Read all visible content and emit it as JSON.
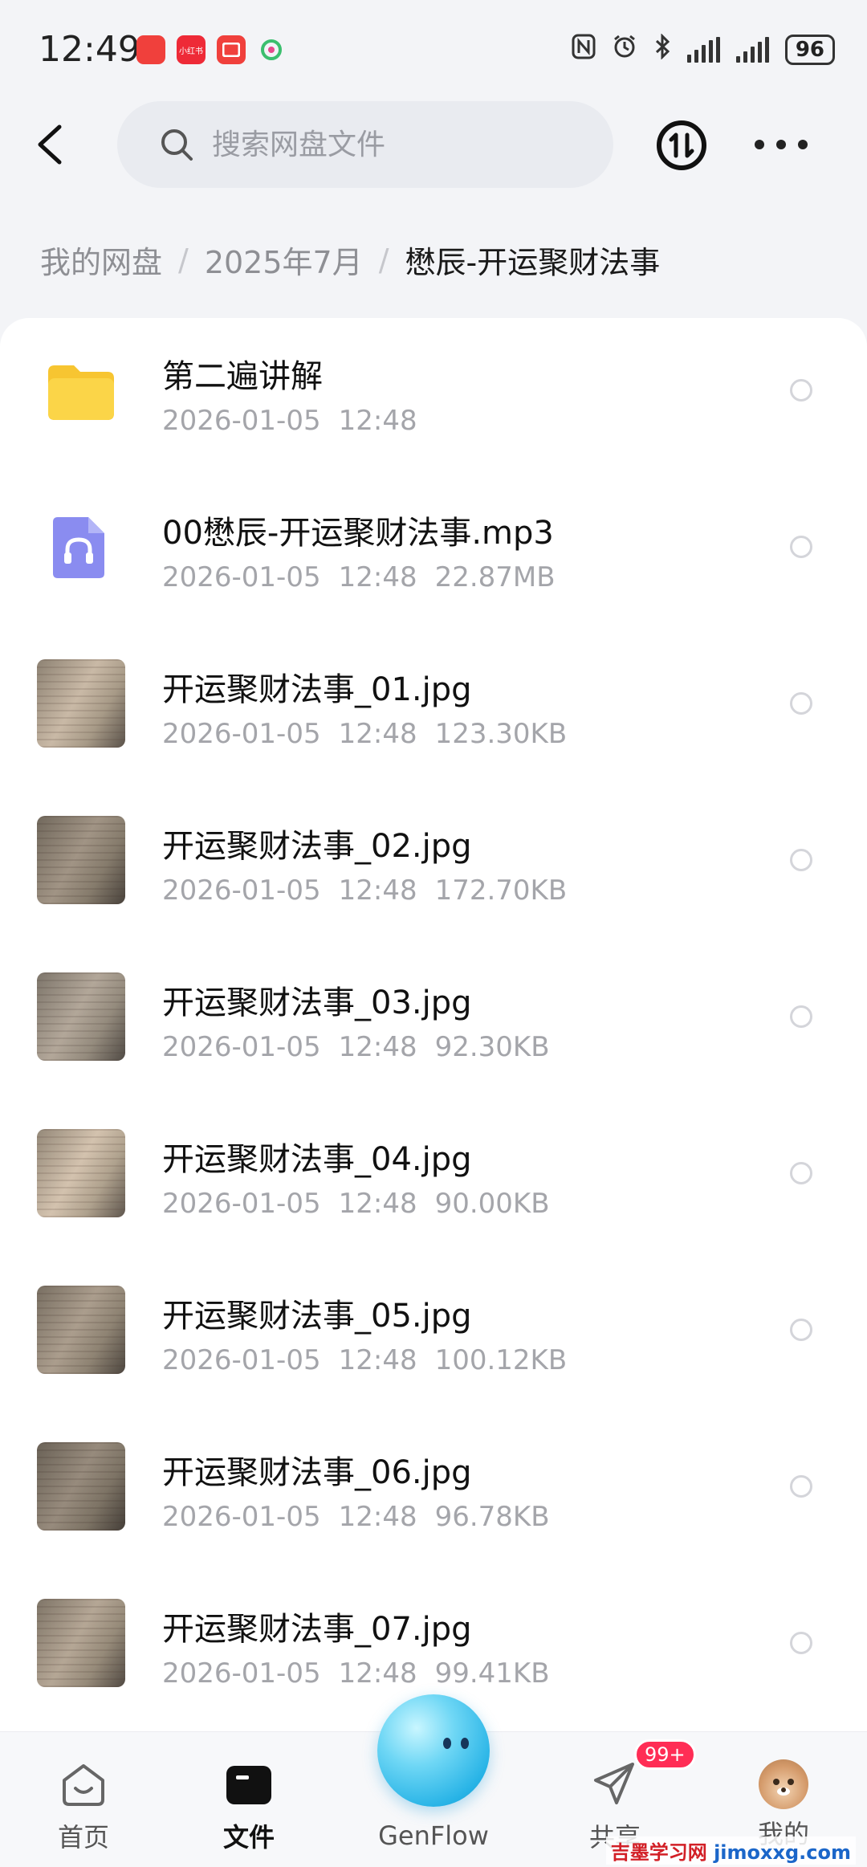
{
  "status_bar": {
    "time": "12:49",
    "battery": "96",
    "apps": [
      {
        "name": "app-badge-1",
        "color": "#f0403c"
      },
      {
        "name": "xiaohongshu-badge",
        "color": "#ee2a37",
        "label": "小红书"
      },
      {
        "name": "app-badge-3",
        "color": "#f0403c"
      },
      {
        "name": "app-badge-4",
        "color": "#3bbf6e"
      }
    ]
  },
  "header": {
    "search_placeholder": "搜索网盘文件"
  },
  "breadcrumb": {
    "root": "我的网盘",
    "level1": "2025年7月",
    "current": "懋辰-开运聚财法事"
  },
  "files": [
    {
      "name": "第二遍讲解",
      "date": "2026-01-05",
      "time": "12:48",
      "size": "",
      "type": "folder"
    },
    {
      "name": "00懋辰-开运聚财法事.mp3",
      "date": "2026-01-05",
      "time": "12:48",
      "size": "22.87MB",
      "type": "audio"
    },
    {
      "name": "开运聚财法事_01.jpg",
      "date": "2026-01-05",
      "time": "12:48",
      "size": "123.30KB",
      "type": "image"
    },
    {
      "name": "开运聚财法事_02.jpg",
      "date": "2026-01-05",
      "time": "12:48",
      "size": "172.70KB",
      "type": "image"
    },
    {
      "name": "开运聚财法事_03.jpg",
      "date": "2026-01-05",
      "time": "12:48",
      "size": "92.30KB",
      "type": "image"
    },
    {
      "name": "开运聚财法事_04.jpg",
      "date": "2026-01-05",
      "time": "12:48",
      "size": "90.00KB",
      "type": "image"
    },
    {
      "name": "开运聚财法事_05.jpg",
      "date": "2026-01-05",
      "time": "12:48",
      "size": "100.12KB",
      "type": "image"
    },
    {
      "name": "开运聚财法事_06.jpg",
      "date": "2026-01-05",
      "time": "12:48",
      "size": "96.78KB",
      "type": "image"
    },
    {
      "name": "开运聚财法事_07.jpg",
      "date": "2026-01-05",
      "time": "12:48",
      "size": "99.41KB",
      "type": "image"
    }
  ],
  "nav": {
    "home": "首页",
    "files": "文件",
    "genflow": "GenFlow",
    "share": "共享",
    "share_badge": "99+",
    "me": "我的"
  },
  "watermark": {
    "cn": "吉墨学习网",
    "url": "jimoxxg.com"
  },
  "colors": {
    "folder": "#f7c531",
    "audio_icon": "#8a8cf0",
    "badge": "#ff2d55",
    "orb": "#27b3e6"
  }
}
